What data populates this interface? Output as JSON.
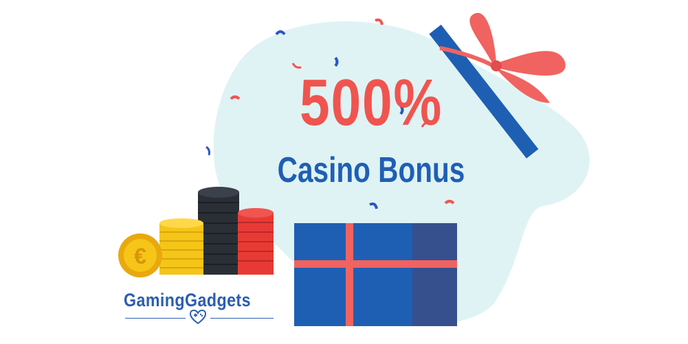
{
  "banner": {
    "bonus_percent": "500%",
    "bonus_label": "Casino Bonus"
  },
  "brand": {
    "logo_text": "GamingGadgets",
    "logo_icon": "heart-gamepad-icon"
  },
  "illustration": {
    "icons": [
      "gift-box-icon",
      "gift-ribbon-bow-icon",
      "gift-lid-icon",
      "euro-coin-icon",
      "gold-coin-stack-icon",
      "black-chip-stack-icon",
      "red-chip-stack-icon",
      "confetti-icon"
    ]
  },
  "colors": {
    "background_blob": "#dff3f5",
    "headline_red": "#f0544f",
    "headline_blue": "#1f5fb4",
    "gift_blue": "#1e5fb3",
    "gift_side": "#35508c",
    "ribbon": "#f06360",
    "gold": "#f5c518",
    "chip_black": "#2a2f36",
    "chip_red": "#e83a35",
    "logo_blue": "#2b5db0"
  }
}
